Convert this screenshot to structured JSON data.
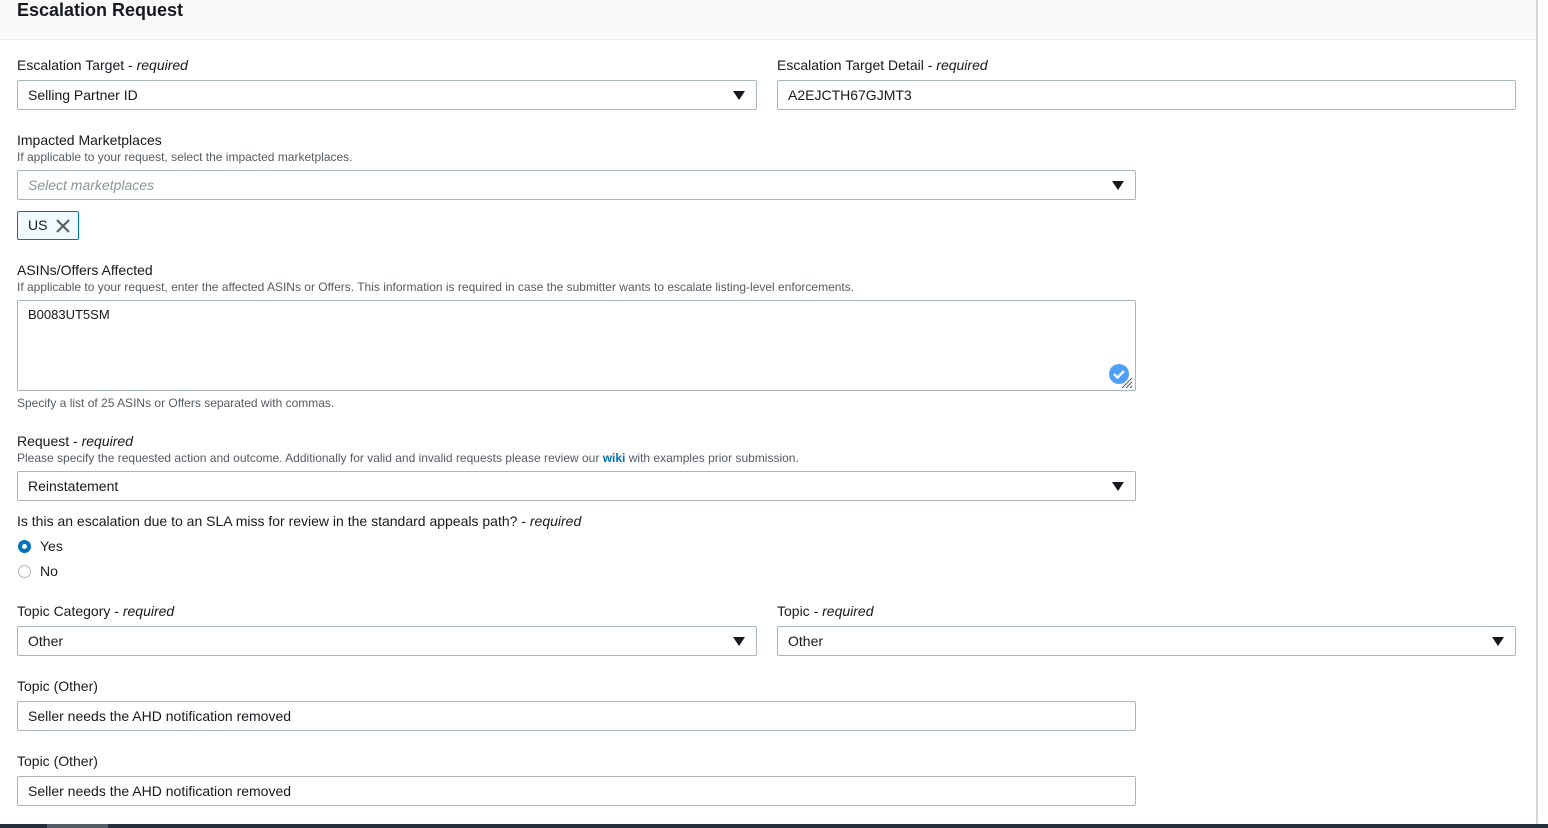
{
  "page": {
    "title": "Escalation Request",
    "required_text": "required"
  },
  "fields": {
    "escalation_target": {
      "label": "Escalation Target",
      "value": "Selling Partner ID"
    },
    "escalation_target_detail": {
      "label": "Escalation Target Detail",
      "value": "A2EJCTH67GJMT3"
    },
    "impacted_marketplaces": {
      "label": "Impacted Marketplaces",
      "description": "If applicable to your request, select the impacted marketplaces.",
      "placeholder": "Select marketplaces",
      "tokens": [
        "US"
      ]
    },
    "asins": {
      "label": "ASINs/Offers Affected",
      "description": "If applicable to your request, enter the affected ASINs or Offers. This information is required in case the submitter wants to escalate listing-level enforcements.",
      "value": "B0083UT5SM",
      "hint": "Specify a list of 25 ASINs or Offers separated with commas."
    },
    "request": {
      "label": "Request",
      "description_before": "Please specify the requested action and outcome. Additionally for valid and invalid requests please review our",
      "link_text": "wiki",
      "description_after": "with examples prior submission.",
      "value": "Reinstatement"
    },
    "sla_miss": {
      "label": "Is this an escalation due to an SLA miss for review in the standard appeals path?",
      "options": [
        "Yes",
        "No"
      ],
      "selected": "Yes"
    },
    "topic_category": {
      "label": "Topic Category",
      "value": "Other"
    },
    "topic": {
      "label": "Topic",
      "value": "Other"
    },
    "topic_other_1": {
      "label": "Topic (Other)",
      "value": "Seller needs the AHD notification removed"
    },
    "topic_other_2": {
      "label": "Topic (Other)",
      "value": "Seller needs the AHD notification removed"
    }
  },
  "colors": {
    "accent": "#0073bb",
    "border": "#aab7b8",
    "text": "#16191f",
    "muted": "#545b64"
  }
}
